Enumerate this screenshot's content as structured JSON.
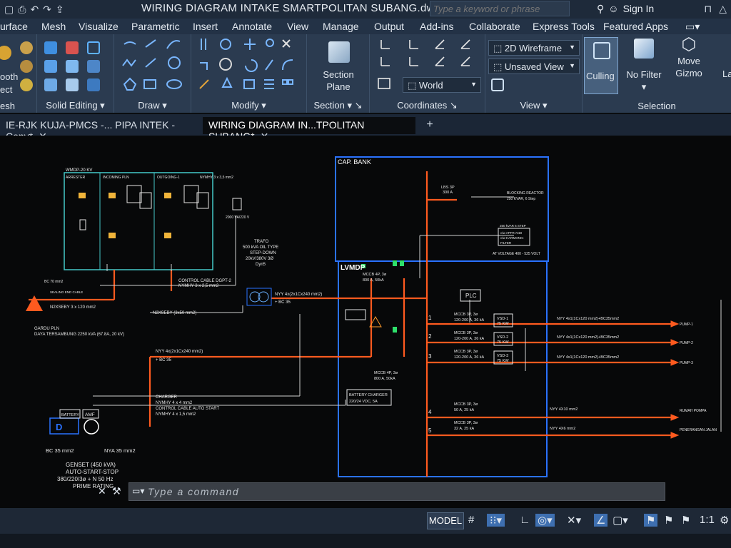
{
  "titlebar": {
    "title": "WIRING DIAGRAM INTAKE SMARTPOLITAN SUBANG.dwg",
    "search_placeholder": "Type a keyword or phrase",
    "signin_label": "Sign In"
  },
  "menu": [
    "urface",
    "Mesh",
    "Visualize",
    "Parametric",
    "Insert",
    "Annotate",
    "View",
    "Manage",
    "Output",
    "Add-ins",
    "Collaborate",
    "Express Tools",
    "Featured Apps"
  ],
  "ribbon": {
    "left_labels": [
      "ooth",
      "ect",
      "esh"
    ],
    "panels": {
      "solid_editing": "Solid Editing",
      "draw": "Draw",
      "modify": "Modify",
      "section": "Section",
      "coordinates": "Coordinates",
      "view": "View",
      "selection": "Selection"
    },
    "section_plane": [
      "Section",
      "Plane"
    ],
    "world_dropdown": "World",
    "visual_style": "2D Wireframe",
    "named_view": "Unsaved View",
    "culling": "Culling",
    "no_filter": "No Filter",
    "move_gizmo": [
      "Move",
      "Gizmo"
    ],
    "cut_label": "La"
  },
  "tabs": [
    {
      "label": "IE-RJK KUJA-PMCS -... PIPA INTEK - Copy*"
    },
    {
      "label": "WIRING DIAGRAM IN...TPOLITAN SUBANG*"
    }
  ],
  "drawing": {
    "cap_bank": "CAP. BANK",
    "lvmdp": "LVMDP",
    "plc": "PLC",
    "wmdp": "WMDP-20 KV",
    "arrester": "ARRESTER",
    "incoming": "INCOMING PLN",
    "outgoing": "OUTGOING-1",
    "nyhy_top": "NYMHY 3 x 3,5 mm2",
    "va_rating": "2000 VA/220 V",
    "trafo": [
      "TRAFO",
      "500 kVA OIL TYPE",
      "STEP-DOWN",
      "20kV/380V 3Ø",
      "Dyn5"
    ],
    "control_cable": [
      "CONTROL CABLE  DGPT-2",
      "NYMHY 3 x 2,5 mm2"
    ],
    "bc70": "BC 70 mm2",
    "sealing": "SEALING END CABLE",
    "n2xseby1": "N2XSEBY 3 x 120 mm2",
    "n2xseby2": "N2XSEBY (3x50 mm2)",
    "gardu": [
      "GARDU PLN",
      "DAYA TERSAMBUNG 2250 kVA (67.8A, 20 kV)"
    ],
    "nyy_trafo": [
      "NYY 4x(2x1Cx240 mm2)",
      "+ BC 35"
    ],
    "nyy_genset": [
      "NYY 4x(2x1Cx240 mm2)",
      "+ BC 35"
    ],
    "lbs": [
      "LBS 3P",
      "300 A"
    ],
    "blocking": [
      "BLOCKING REACTOR",
      "250 KVAR, 6 Step"
    ],
    "apfr": [
      "250 kVAR 6 STEP",
      "c/w APFR AND",
      "c/w HARMONIC",
      "FILTER"
    ],
    "at_voltage": "AT VOLTAGE 400 - 525 VOLT",
    "mccb_main1": [
      "MCCB 4P, 3ø",
      "800 A, 50kA"
    ],
    "mccb_main2": [
      "MCCB 4P, 3ø",
      "800 A, 50kA"
    ],
    "battery_charger": [
      "BATTERY CHARGER",
      "220/24 VDC, 5A"
    ],
    "feeders": [
      {
        "no": "1",
        "mccb": [
          "MCCB 3P, 3ø",
          "120-200 A, 36 kA"
        ],
        "vsd": [
          "VSD-1",
          "75 KW"
        ],
        "cable": "NYY 4x1(1Cx120 mm2)+BC35mm2",
        "dest": "PUMP-1"
      },
      {
        "no": "2",
        "mccb": [
          "MCCB 3P, 3ø",
          "120-200 A, 36 kA"
        ],
        "vsd": [
          "VSD-2",
          "75 KW"
        ],
        "cable": "NYY 4x1(1Cx120 mm2)+BC35mm2",
        "dest": "PUMP-2"
      },
      {
        "no": "3",
        "mccb": [
          "MCCB 3P, 3ø",
          "120-200 A, 36 kA"
        ],
        "vsd": [
          "VSD-3",
          "75 KW"
        ],
        "cable": "NYY 4x1(1Cx120 mm2)+BC35mm2",
        "dest": "PUMP-3"
      },
      {
        "no": "4",
        "mccb": [
          "MCCB 3P, 3ø",
          "50 A, 25 kA"
        ],
        "cable": "NYY 4X10 mm2",
        "dest": "RUMAH POMPA"
      },
      {
        "no": "5",
        "mccb": [
          "MCCB 3P, 3ø",
          "32 A, 25 kA"
        ],
        "cable": "NYY 4X6 mm2",
        "dest": "PENERANGAN JALAN"
      }
    ],
    "charger": [
      "CHARGER",
      "NYMHY 4 x 4 mm2",
      "CONTROL CABLE  AUTO START",
      "NYMHY 4 x 1,5 mm2"
    ],
    "battery": "BATTERY",
    "amf": "AMF",
    "bc35": "BC 35 mm2",
    "nya35": "NYA 35 mm2",
    "genset": [
      "GENSET (450 kVA)",
      "AUTO-START-STOP",
      "380/220/3ø + N 50 Hz",
      "PRIME RATING"
    ]
  },
  "command": {
    "placeholder": "Type a command"
  },
  "status": {
    "model": "MODEL",
    "scale": "1:1"
  },
  "colors": {
    "accent": "#1f6fe0",
    "orange": "#ff5a1f",
    "cyan": "#45c9c9"
  }
}
